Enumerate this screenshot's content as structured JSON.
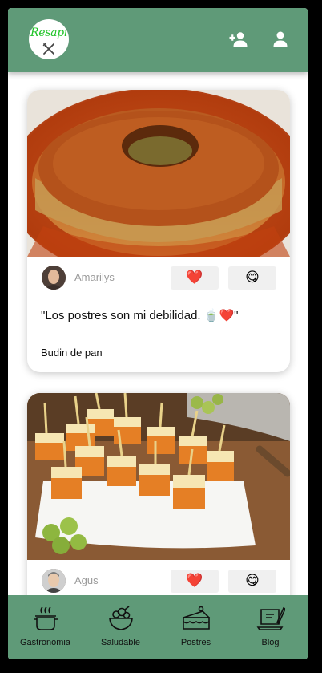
{
  "app": {
    "logo_text": "Resapi"
  },
  "header": {
    "add_user_icon": "person-add-icon",
    "profile_icon": "person-icon"
  },
  "posts": [
    {
      "author": "Amarilys",
      "quote": "\"Los postres son mi debilidad. 🍵❤️\"",
      "dish": "Budin de pan",
      "like_emoji": "❤️",
      "yum_emoji": "😋"
    },
    {
      "author": "Agus",
      "like_emoji": "❤️",
      "yum_emoji": "😋"
    }
  ],
  "nav": [
    {
      "label": "Gastronomia",
      "icon": "cooking-pot-icon"
    },
    {
      "label": "Saludable",
      "icon": "salad-bowl-icon"
    },
    {
      "label": "Postres",
      "icon": "cake-slice-icon"
    },
    {
      "label": "Blog",
      "icon": "laptop-pen-icon"
    }
  ],
  "colors": {
    "primary": "#5f9a78",
    "logo_green": "#20c428",
    "button_bg": "#f0f0f0"
  }
}
